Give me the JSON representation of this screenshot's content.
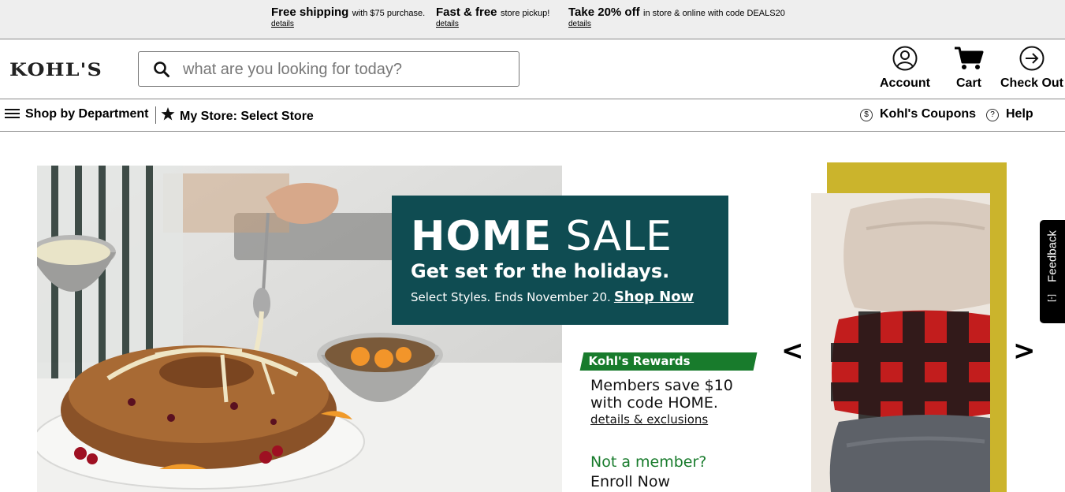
{
  "promos": [
    {
      "bold": "Free shipping",
      "text": "with $75 purchase.",
      "link": "details"
    },
    {
      "bold": "Fast & free",
      "text": "store pickup!",
      "link": "details"
    },
    {
      "bold": "Take 20% off",
      "text": "in store & online with code DEALS20",
      "link": "details"
    }
  ],
  "header": {
    "logo": "KOHL'S",
    "search_placeholder": "what are you looking for today?",
    "account_label": "Account",
    "cart_label": "Cart",
    "checkout_label": "Check Out"
  },
  "nav": {
    "shop_by_department": "Shop by Department",
    "my_store": "My Store: Select Store",
    "coupons": "Kohl's Coupons",
    "help": "Help"
  },
  "hero": {
    "title_bold": "HOME",
    "title_light": "SALE",
    "subtitle": "Get set for the holidays.",
    "details_text": "Select Styles. Ends November 20.",
    "shop_now": "Shop Now",
    "rewards_tag": "Kohl's Rewards Exclusive",
    "members_line1": "Members save $10",
    "members_line2": "with code HOME.",
    "exclusions_link": "details & exclusions",
    "not_member": "Not a member?",
    "enroll": "Enroll Now"
  },
  "carousel": {
    "prev": "<",
    "next": ">"
  },
  "feedback": {
    "label": "Feedback",
    "icon": "[-]"
  },
  "colors": {
    "banner_bg": "#0f4c52",
    "rewards_green": "#187b2c",
    "gold": "#cbb42c",
    "promo_bar_bg": "#eeeeee"
  }
}
